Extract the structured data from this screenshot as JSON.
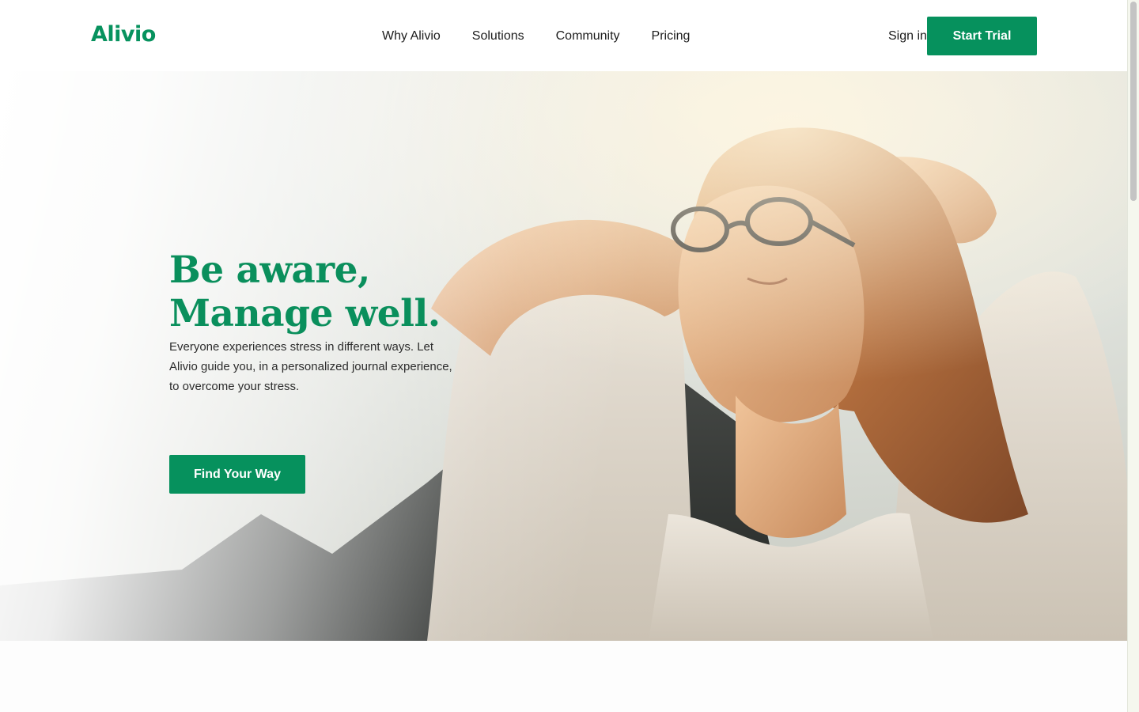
{
  "brand": {
    "logo_text": "Alivio",
    "accent_color": "#06915d"
  },
  "header": {
    "nav": [
      {
        "label": "Why Alivio"
      },
      {
        "label": "Solutions"
      },
      {
        "label": "Community"
      },
      {
        "label": "Pricing"
      }
    ],
    "sign_in_label": "Sign in",
    "cta_label": "Start Trial"
  },
  "hero": {
    "title_line_1": "Be aware,",
    "title_line_2": "Manage well.",
    "description": "Everyone experiences stress in different ways. Let Alivio guide you, in a personalized journal experience, to overcome your stress.",
    "cta_label": "Find Your Way",
    "image_subject": "woman-relaxing-in-sunlight"
  }
}
